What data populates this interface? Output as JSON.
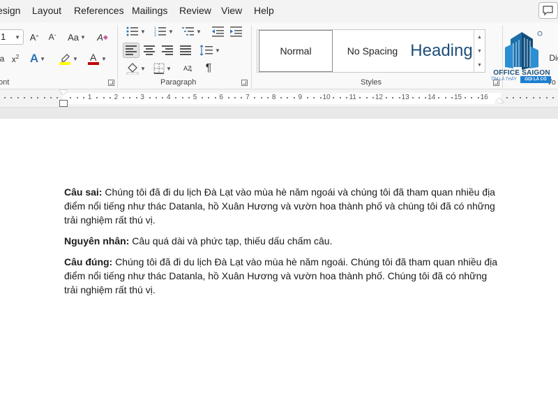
{
  "menu": {
    "tabs": [
      "esign",
      "Layout",
      "References",
      "Mailings",
      "Review",
      "View",
      "Help"
    ]
  },
  "ribbon": {
    "font": {
      "size_value": "1",
      "grow_label": "A",
      "shrink_label": "A",
      "case_label": "Aa",
      "clear_label": "A",
      "group_label": "ont"
    },
    "paragraph": {
      "group_label": "Paragraph",
      "pilcrow": "¶",
      "sort_label": "AZ"
    },
    "styles": {
      "group_label": "Styles",
      "items": [
        "Normal",
        "No Spacing",
        "Heading"
      ]
    },
    "voice": {
      "group_label": "Vo",
      "dictate_label": "Dic"
    },
    "colors": {
      "font_color": "#c00000",
      "highlight": "#ffff00",
      "text_effects": "#2e75b6"
    }
  },
  "ruler": {
    "labels": [
      "1",
      "2",
      "3",
      "4",
      "5",
      "6",
      "7",
      "8",
      "9",
      "10",
      "11",
      "12",
      "13",
      "14",
      "15",
      "16"
    ]
  },
  "document": {
    "paragraphs": [
      {
        "label": "Câu sai:",
        "text": " Chúng tôi đã đi du lịch Đà Lạt vào mùa hè năm ngoái và chúng tôi đã tham quan nhiều địa điểm nổi tiếng như thác Datanla, hồ Xuân Hương và vườn hoa thành phố và chúng tôi đã có những trải nghiệm rất thú vị."
      },
      {
        "label": "Nguyên nhân:",
        "text": " Câu quá dài và phức tạp, thiếu dấu chấm câu."
      },
      {
        "label": "Câu đúng:",
        "text": " Chúng tôi đã đi du lịch Đà Lạt vào mùa hè năm ngoái. Chúng tôi đã tham quan nhiều địa điểm nổi tiếng như thác Datanla, hồ Xuân Hương và vườn hoa thành phố. Chúng tôi đã có những trải nghiệm rất thú vị."
      }
    ]
  },
  "logo": {
    "name": "OFFICE SAIGON",
    "tagline": "TÌM LÀ THẤY",
    "badge": "GỌI LÀ CÓ"
  }
}
